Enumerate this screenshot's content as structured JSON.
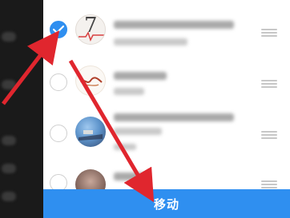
{
  "move_button": {
    "label": "移动"
  },
  "contacts": [
    {
      "selected": true,
      "avatar": "calendar-avatar-icon"
    },
    {
      "selected": false,
      "avatar": "calligraphy-avatar-icon"
    },
    {
      "selected": false,
      "avatar": "landscape-avatar-icon"
    },
    {
      "selected": false,
      "avatar": "portrait-avatar-icon"
    }
  ],
  "avatar1_glyph": "7",
  "colors": {
    "accent": "#2f8ff0",
    "annotation_arrow": "#e0262e",
    "panel_bg": "#ffffff",
    "backdrop": "#141414"
  }
}
